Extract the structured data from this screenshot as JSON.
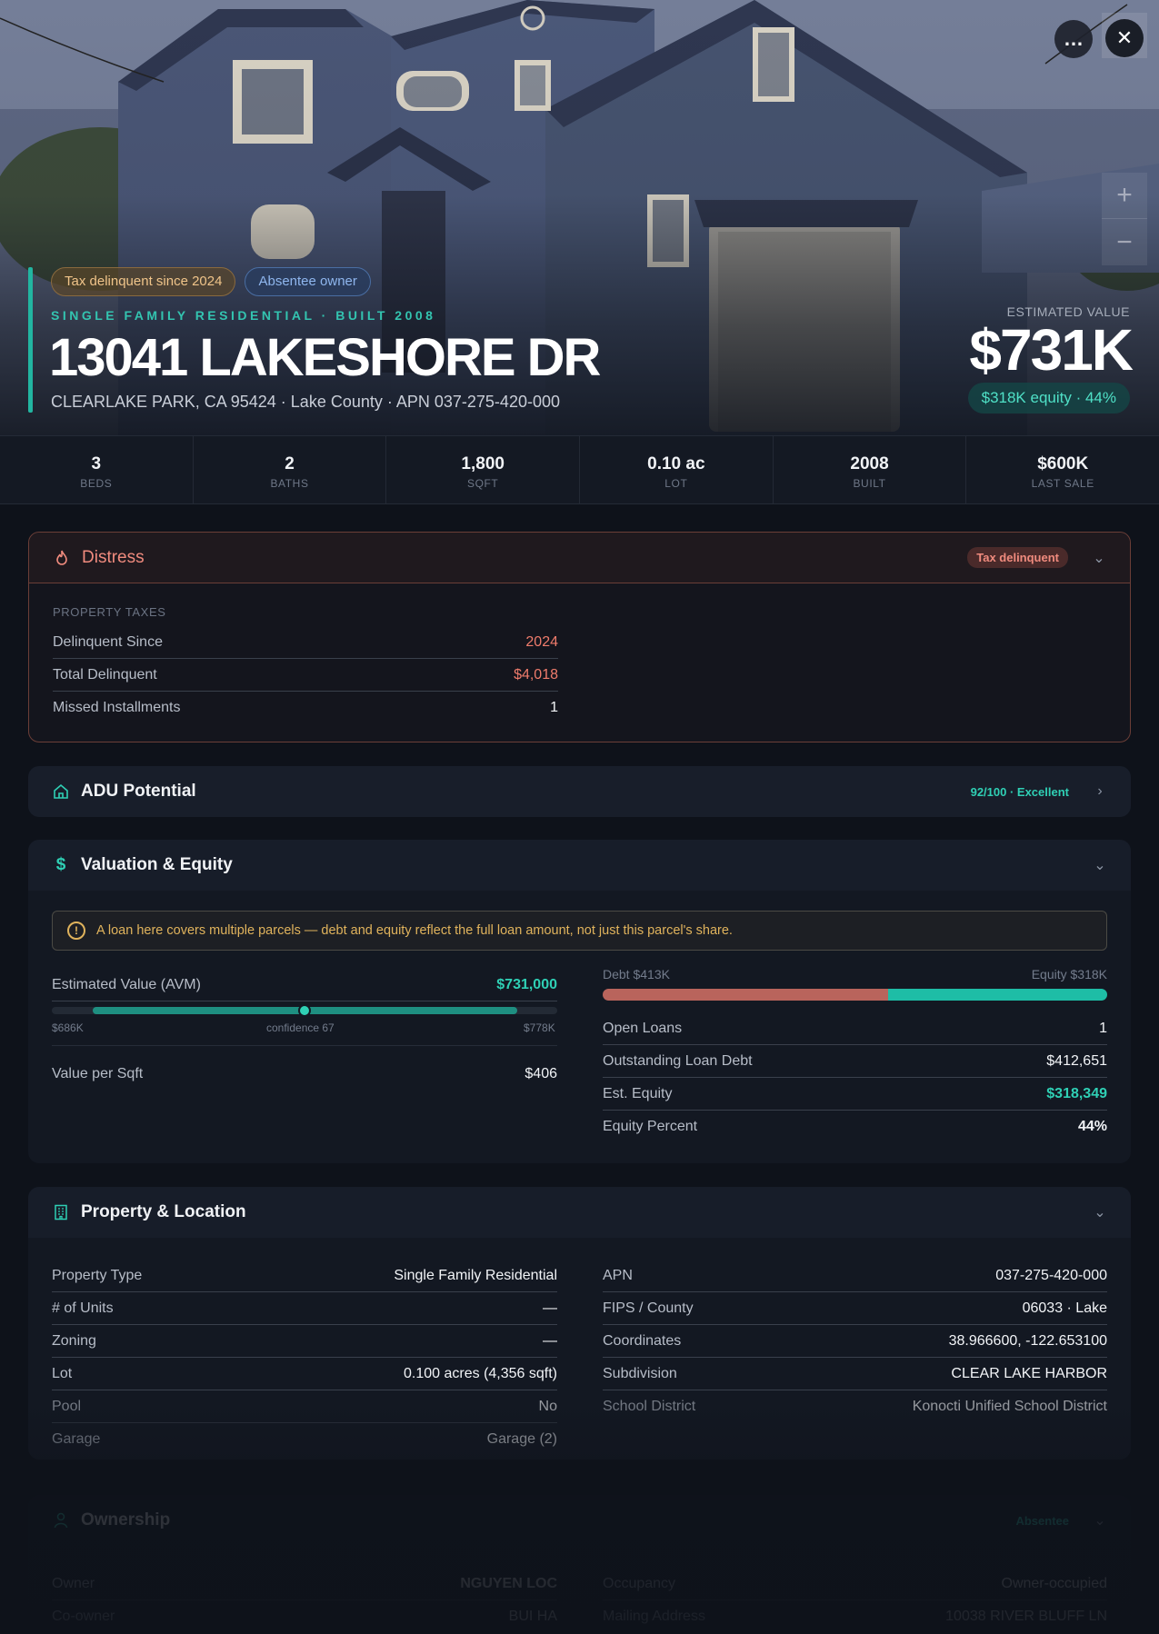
{
  "hero": {
    "tags": [
      "Tax delinquent since 2024",
      "Absentee owner"
    ],
    "subtype": "SINGLE FAMILY RESIDENTIAL · BUILT 2008",
    "address": "13041 LAKESHORE DR",
    "location": "CLEARLAKE PARK, CA 95424 · Lake County · APN 037-275-420-000",
    "est_label": "ESTIMATED VALUE",
    "est_value": "$731K",
    "equity_pill": "$318K equity · 44%",
    "more_icon": "…",
    "close_icon": "✕",
    "zoom_in": "+",
    "zoom_out": "−"
  },
  "stats": [
    {
      "value": "3",
      "label": "BEDS"
    },
    {
      "value": "2",
      "label": "BATHS"
    },
    {
      "value": "1,800",
      "label": "SQFT"
    },
    {
      "value": "0.10 ac",
      "label": "LOT"
    },
    {
      "value": "2008",
      "label": "BUILT"
    },
    {
      "value": "$600K",
      "label": "LAST SALE"
    }
  ],
  "distress": {
    "title": "Distress",
    "badge": "Tax delinquent",
    "section": "PROPERTY TAXES",
    "rows": [
      {
        "k": "Delinquent Since",
        "v": "2024"
      },
      {
        "k": "Total Delinquent",
        "v": "$4,018"
      },
      {
        "k": "Missed Installments",
        "v": "1"
      }
    ]
  },
  "adu": {
    "title": "ADU Potential",
    "score": "92/100 · Excellent"
  },
  "valuation": {
    "title": "Valuation & Equity",
    "warning": "A loan here covers multiple parcels — debt and equity reflect the full loan amount, not just this parcel's share.",
    "avm_label": "Estimated Value (AVM)",
    "avm_value": "$731,000",
    "avm_low": "$686K",
    "avm_confidence": "confidence 67",
    "avm_high": "$778K",
    "value_per_sqft_label": "Value per Sqft",
    "value_per_sqft": "$406",
    "debt_label": "Debt $413K",
    "equity_label": "Equity $318K",
    "debt_share": 0.565,
    "rows": [
      {
        "k": "Open Loans",
        "v": "1"
      },
      {
        "k": "Outstanding Loan Debt",
        "v": "$412,651"
      },
      {
        "k": "Est. Equity",
        "v": "$318,349"
      },
      {
        "k": "Equity Percent",
        "v": "44%"
      }
    ]
  },
  "property": {
    "title": "Property & Location",
    "left": [
      {
        "k": "Property Type",
        "v": "Single Family Residential"
      },
      {
        "k": "# of Units",
        "v": "—"
      },
      {
        "k": "Zoning",
        "v": "—"
      },
      {
        "k": "Lot",
        "v": "0.100 acres (4,356 sqft)"
      },
      {
        "k": "Pool",
        "v": "No"
      },
      {
        "k": "Garage",
        "v": "Garage (2)"
      }
    ],
    "right": [
      {
        "k": "APN",
        "v": "037-275-420-000"
      },
      {
        "k": "FIPS / County",
        "v": "06033 · Lake"
      },
      {
        "k": "Coordinates",
        "v": "38.966600, -122.653100"
      },
      {
        "k": "Subdivision",
        "v": "CLEAR LAKE HARBOR"
      },
      {
        "k": "School District",
        "v": "Konocti Unified School District"
      }
    ]
  },
  "ownership": {
    "title": "Ownership",
    "badge": "Absentee",
    "left": [
      {
        "k": "Owner",
        "v": "NGUYEN LOC"
      },
      {
        "k": "Co-owner",
        "v": "BUI HA"
      }
    ],
    "right": [
      {
        "k": "Occupancy",
        "v": "Owner-occupied"
      },
      {
        "k": "Mailing Address",
        "v": "10038 RIVER BLUFF LN"
      }
    ]
  },
  "colors": {
    "accent": "#2fd0b5",
    "danger": "#ef7c6c",
    "warning": "#e0b35c",
    "background": "#0e121a"
  }
}
